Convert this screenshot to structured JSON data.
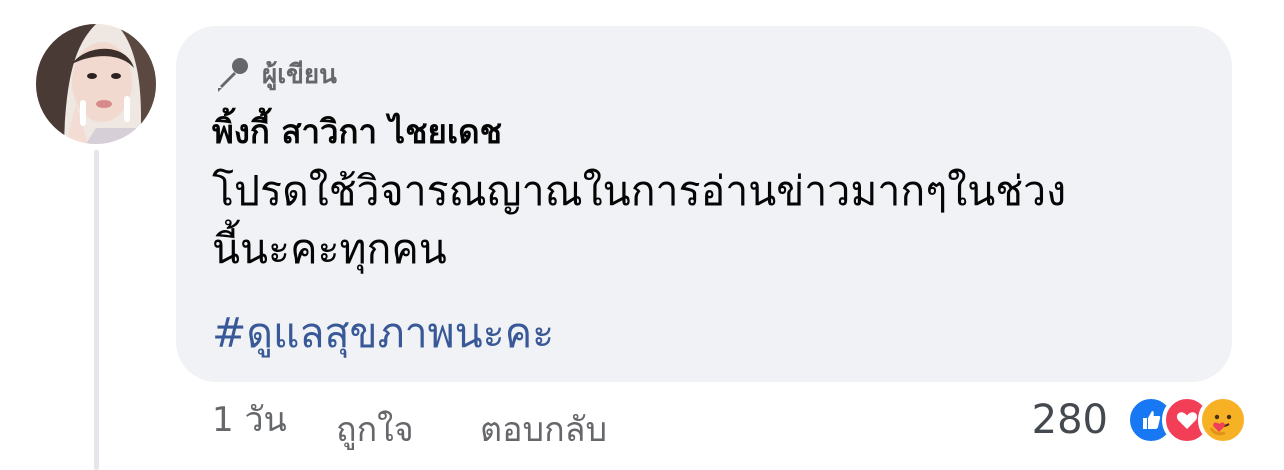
{
  "comment": {
    "badge_label": "ผู้เขียน",
    "author": "พิ้งกี้ สาวิกา ไชยเดช",
    "text": "โปรดใช้วิจารณญาณในการอ่านข่าวมากๆในช่วง\nนี้นะคะทุกคน",
    "hashtag": "#ดูแลสุขภาพนะคะ"
  },
  "meta": {
    "time": "1 วัน",
    "like_label": "ถูกใจ",
    "reply_label": "ตอบกลับ"
  },
  "reactions": {
    "count": "280",
    "icons": [
      "like-icon",
      "love-icon",
      "care-icon"
    ]
  },
  "colors": {
    "bubble": "#f0f2f5",
    "hashtag": "#385898",
    "like": "#1877f2",
    "love": "#f33e58",
    "care": "#f7b125"
  }
}
